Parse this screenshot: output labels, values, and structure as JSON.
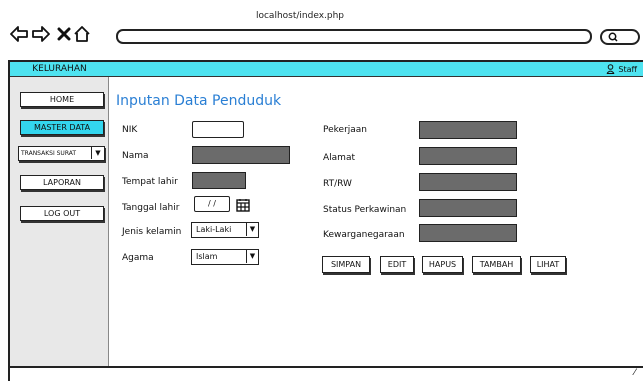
{
  "browser": {
    "url": "localhost/index.php",
    "nav_icons": [
      "back-arrow-icon",
      "forward-arrow-icon",
      "close-icon",
      "home-icon"
    ]
  },
  "sidebar": {
    "title": "KELURAHAN",
    "items": [
      {
        "label": "HOME",
        "active": false
      },
      {
        "label": "MASTER DATA",
        "active": true
      },
      {
        "label": "TRANSAKSI SURAT",
        "type": "select"
      },
      {
        "label": "LAPORAN",
        "active": false
      },
      {
        "label": "LOG OUT",
        "active": false
      }
    ]
  },
  "topbar": {
    "user_label": "Staff",
    "accent": "#4ee3f0"
  },
  "form": {
    "title": "Inputan Data Penduduk",
    "left": {
      "nik_label": "NIK",
      "nama_label": "Nama",
      "tempat_label": "Tempat lahir",
      "tanggal_label": "Tanggal lahir",
      "tanggal_value": "/ /",
      "jk_label": "Jenis kelamin",
      "jk_value": "Laki-Laki",
      "agama_label": "Agama",
      "agama_value": "Islam"
    },
    "right": {
      "pekerjaan_label": "Pekerjaan",
      "alamat_label": "Alamat",
      "rtrw_label": "RT/RW",
      "status_label": "Status Perkawinan",
      "kewarga_label": "Kewarganegaraan"
    },
    "buttons": {
      "simpan": "SIMPAN",
      "edit": "EDIT",
      "hapus": "HAPUS",
      "tambah": "TAMBAH",
      "lihat": "LIHAT"
    }
  }
}
